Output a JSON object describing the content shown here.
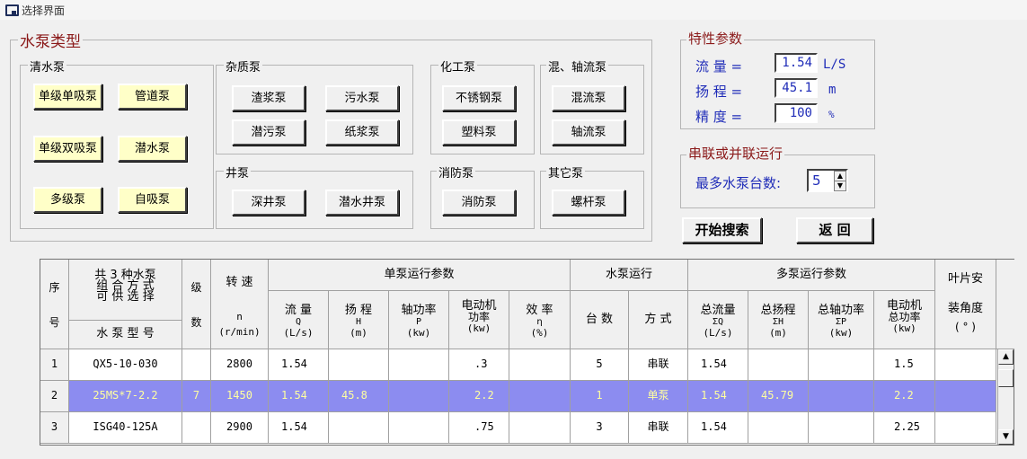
{
  "window": {
    "title": "选择界面"
  },
  "pump_types": {
    "title": "水泵类型",
    "groups": {
      "clean": {
        "title": "清水泵",
        "buttons": [
          "单级单吸泵",
          "管道泵",
          "单级双吸泵",
          "潜水泵",
          "多级泵",
          "自吸泵"
        ]
      },
      "impurity": {
        "title": "杂质泵",
        "buttons": [
          "渣浆泵",
          "污水泵",
          "潜污泵",
          "纸浆泵"
        ]
      },
      "well": {
        "title": "井泵",
        "buttons": [
          "深井泵",
          "潜水井泵"
        ]
      },
      "chemical": {
        "title": "化工泵",
        "buttons": [
          "不锈钢泵",
          "塑料泵"
        ]
      },
      "mixed": {
        "title": "混、轴流泵",
        "buttons": [
          "混流泵",
          "轴流泵"
        ]
      },
      "fire": {
        "title": "消防泵",
        "buttons": [
          "消防泵"
        ]
      },
      "other": {
        "title": "其它泵",
        "buttons": [
          "螺杆泵"
        ]
      }
    }
  },
  "characteristics": {
    "title": "特性参数",
    "flow": {
      "label": "流  量 =",
      "value": "1.54",
      "unit": "L/S"
    },
    "head": {
      "label": "扬  程 =",
      "value": "45.1",
      "unit": "m"
    },
    "precision": {
      "label": "精  度 =",
      "value": "100",
      "unit": "%"
    }
  },
  "operation": {
    "title": "串联或并联运行",
    "max_label": "最多水泵台数:",
    "max_value": "5"
  },
  "actions": {
    "search": "开始搜索",
    "back": "返  回"
  },
  "table": {
    "headers": {
      "seq": [
        "序",
        "号"
      ],
      "combo": [
        "共 3 种水泵",
        "组 合 方 式",
        "可 供 选 择"
      ],
      "model": "水 泵 型 号",
      "stages": [
        "级",
        "数"
      ],
      "speed": [
        "转  速",
        "n",
        "(r/min)"
      ],
      "single": "单泵运行参数",
      "flow": [
        "流  量",
        "Q",
        "(L/s)"
      ],
      "head": [
        "扬 程",
        "H",
        "(m)"
      ],
      "shaft": [
        "轴功率",
        "P",
        "(kw)"
      ],
      "motor": [
        "电动机",
        "功率",
        "(kw)"
      ],
      "eff": [
        "效 率",
        "η",
        "(%)"
      ],
      "pump_run": "水泵运行",
      "count": "台  数",
      "mode": "方 式",
      "multi": "多泵运行参数",
      "tflow": [
        "总流量",
        "ΣQ",
        "(L/s)"
      ],
      "thead": [
        "总扬程",
        "ΣH",
        "(m)"
      ],
      "tshaft": [
        "总轴功率",
        "ΣP",
        "(kw)"
      ],
      "tmotor": [
        "电动机",
        "总功率",
        "(kw)"
      ],
      "blade": [
        "叶片安",
        "装角度",
        "( ° )"
      ]
    },
    "rows": [
      {
        "seq": "1",
        "model": "QX5-10-030",
        "stages": "",
        "speed": "2800",
        "flow": "1.54",
        "head": "",
        "shaft": "",
        "motor": ".3",
        "eff": "",
        "count": "5",
        "mode": "串联",
        "tflow": "1.54",
        "thead": "",
        "tshaft": "",
        "tmotor": "1.5",
        "blade": ""
      },
      {
        "seq": "2",
        "model": "25MS*7-2.2",
        "stages": "7",
        "speed": "1450",
        "flow": "1.54",
        "head": "45.8",
        "shaft": "",
        "motor": "2.2",
        "eff": "",
        "count": "1",
        "mode": "单泵",
        "tflow": "1.54",
        "thead": "45.79",
        "tshaft": "",
        "tmotor": "2.2",
        "blade": ""
      },
      {
        "seq": "3",
        "model": "ISG40-125A",
        "stages": "",
        "speed": "2900",
        "flow": "1.54",
        "head": "",
        "shaft": "",
        "motor": ".75",
        "eff": "",
        "count": "3",
        "mode": "串联",
        "tflow": "1.54",
        "thead": "",
        "tshaft": "",
        "tmotor": "2.25",
        "blade": ""
      }
    ],
    "selected_row": 2
  }
}
